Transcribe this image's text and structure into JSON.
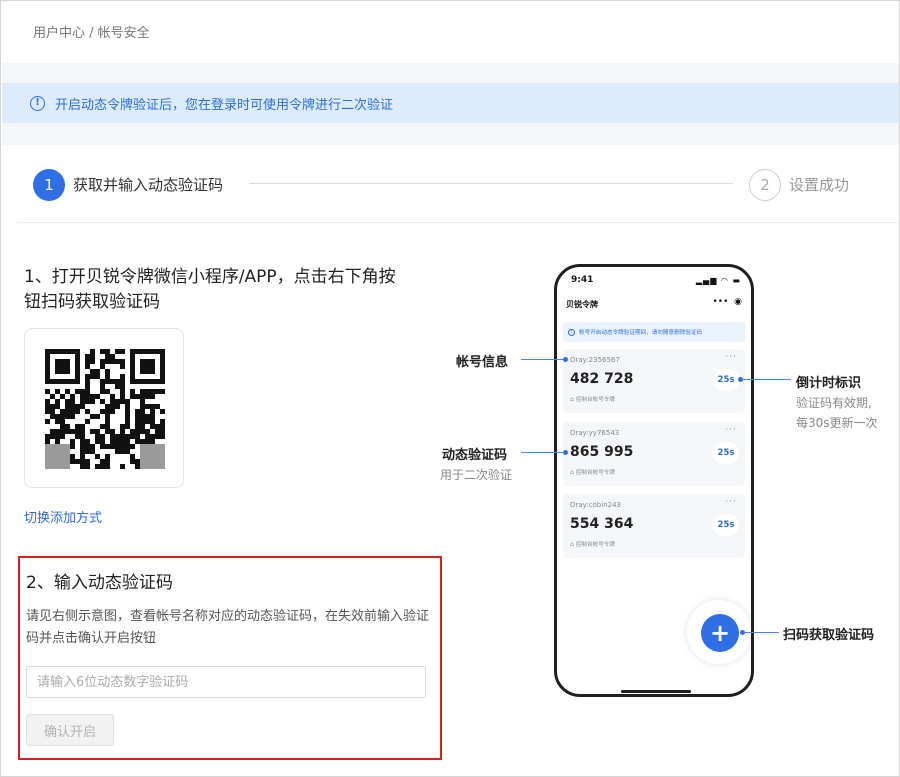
{
  "breadcrumb": "用户中心 / 帐号安全",
  "notice": {
    "icon": "info-circle-icon",
    "text": "开启动态令牌验证后，您在登录时可使用令牌进行二次验证",
    "color": "#2b6fd6",
    "background": "#dcebfd"
  },
  "steps": [
    {
      "number": "1",
      "label": "获取并输入动态验证码",
      "active": true
    },
    {
      "number": "2",
      "label": "设置成功",
      "active": false
    }
  ],
  "section1": {
    "title": "1、打开贝锐令牌微信小程序/APP，点击右下角按钮扫码获取验证码",
    "qr_icon": "qr-code-icon",
    "switch_link": "切换添加方式"
  },
  "section2": {
    "title": "2、输入动态验证码",
    "description": "请见右侧示意图，查看帐号名称对应的动态验证码，在失效前输入验证码并点击确认开启按钮",
    "input_placeholder": "请输入6位动态数字验证码",
    "input_value": "",
    "confirm_label": "确认开启"
  },
  "phone": {
    "time": "9:41",
    "app_title": "贝锐令牌",
    "app_notice": "帐号开启动态令牌验证期间，请勿随意删除验证码",
    "accounts": [
      {
        "name": "Oray:2356567",
        "code": "482 728",
        "timer": "25s",
        "sub": "控制台帐号令牌"
      },
      {
        "name": "Oray:yy76543",
        "code": "865 995",
        "timer": "25s",
        "sub": "控制台帐号令牌"
      },
      {
        "name": "Oray:cobin243",
        "code": "554 364",
        "timer": "25s",
        "sub": "控制台帐号令牌"
      }
    ],
    "fab_label": "+"
  },
  "callouts": {
    "account_info": "帐号信息",
    "countdown": "倒计时标识",
    "countdown_sub1": "验证码有效期,",
    "countdown_sub2": "每30s更新一次",
    "dynamic_code": "动态验证码",
    "dynamic_code_sub": "用于二次验证",
    "scan_code": "扫码获取验证码"
  },
  "colors": {
    "accent": "#2f6fe5",
    "error_border": "#d32222"
  }
}
